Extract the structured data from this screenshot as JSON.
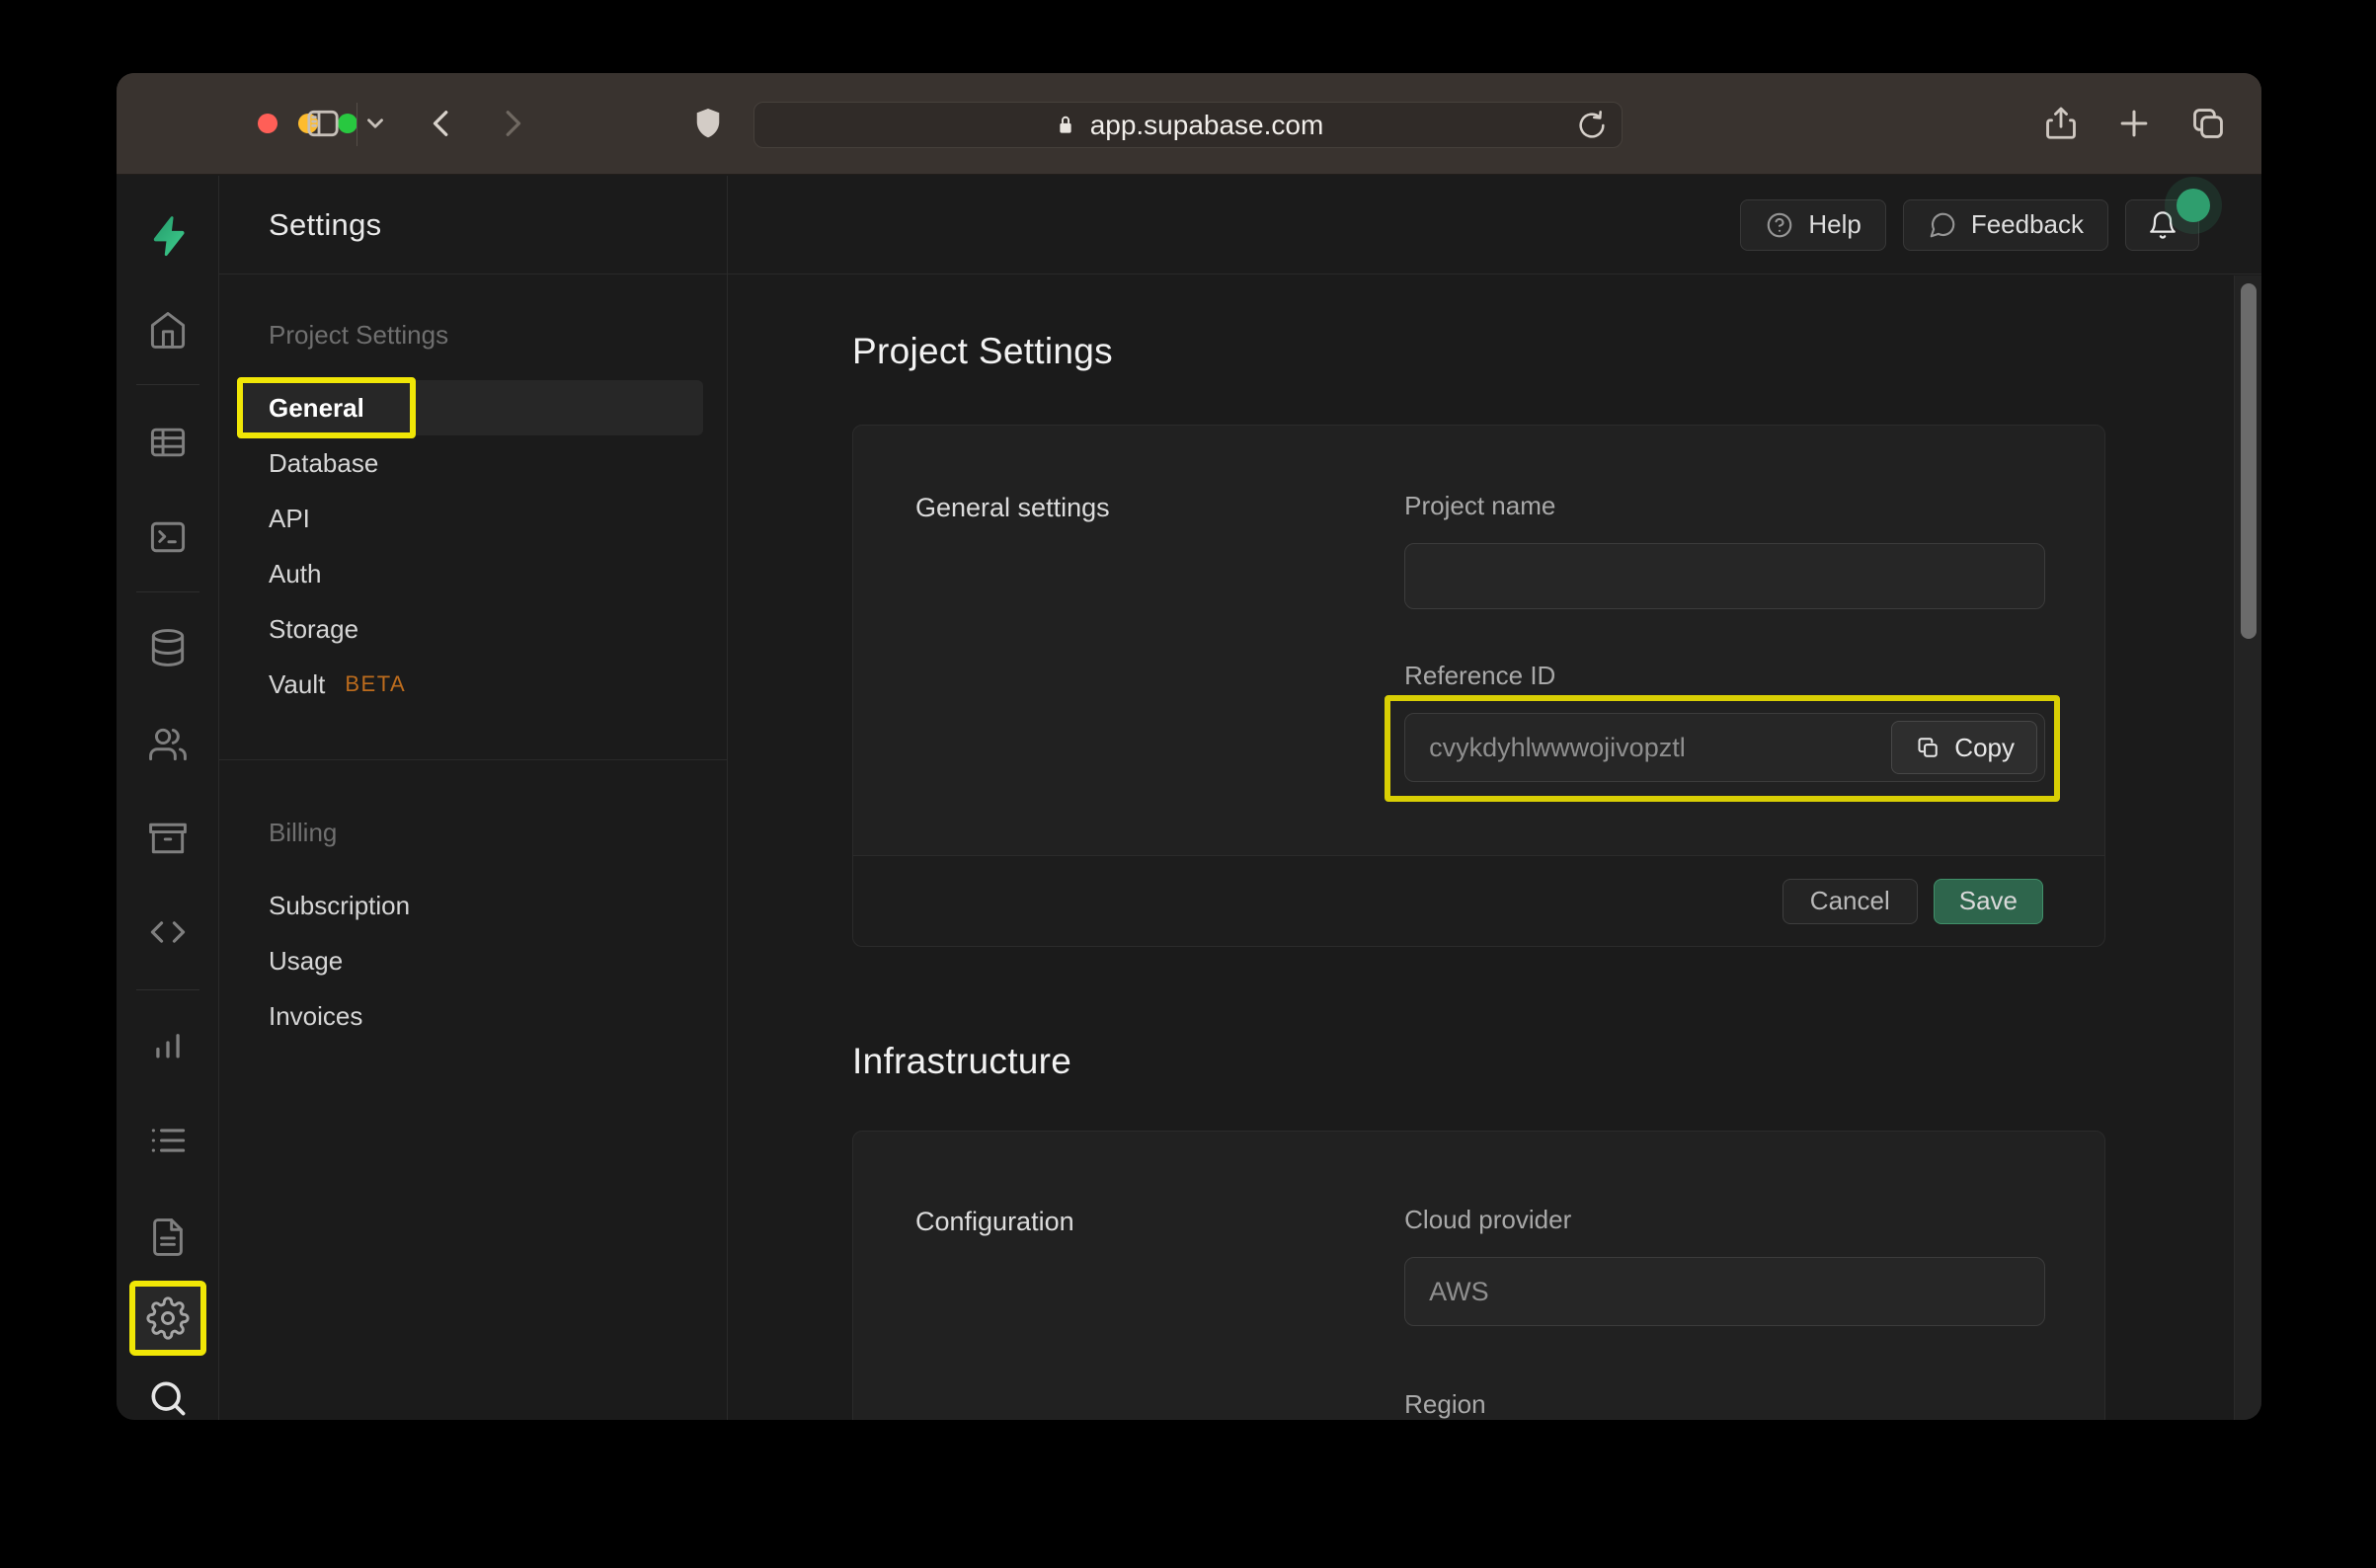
{
  "browser": {
    "url": "app.supabase.com",
    "traffic_light_colors": {
      "close": "#ff5f57",
      "minimize": "#febc2e",
      "zoom": "#28c840"
    }
  },
  "app_header": {
    "title": "Settings",
    "help_label": "Help",
    "feedback_label": "Feedback"
  },
  "rail": {
    "icons": [
      "supabase-logo",
      "home",
      "table-editor",
      "sql-editor",
      "database",
      "auth-users",
      "storage",
      "api-code",
      "reports",
      "logs",
      "docs",
      "settings",
      "search"
    ],
    "active": "settings"
  },
  "sidebar": {
    "sections": [
      {
        "heading": "Project Settings",
        "items": [
          {
            "label": "General",
            "active": true
          },
          {
            "label": "Database"
          },
          {
            "label": "API"
          },
          {
            "label": "Auth"
          },
          {
            "label": "Storage"
          },
          {
            "label": "Vault",
            "badge": "BETA"
          }
        ]
      },
      {
        "heading": "Billing",
        "items": [
          {
            "label": "Subscription"
          },
          {
            "label": "Usage"
          },
          {
            "label": "Invoices"
          }
        ]
      }
    ]
  },
  "main": {
    "page_title": "Project Settings",
    "general_card": {
      "section_label": "General settings",
      "project_name_label": "Project name",
      "project_name_value": "",
      "reference_id_label": "Reference ID",
      "reference_id_value": "cvykdyhlwwwojivopztl",
      "copy_button_label": "Copy",
      "cancel_button_label": "Cancel",
      "save_button_label": "Save"
    },
    "infrastructure_title": "Infrastructure",
    "configuration_card": {
      "section_label": "Configuration",
      "cloud_provider_label": "Cloud provider",
      "cloud_provider_value": "AWS",
      "region_label": "Region"
    }
  },
  "colors": {
    "brand_green": "#3ecf8e",
    "highlight_yellow": "#f0e606",
    "beta_orange": "#bd6c1d",
    "notification_green": "#2f9e6e"
  }
}
